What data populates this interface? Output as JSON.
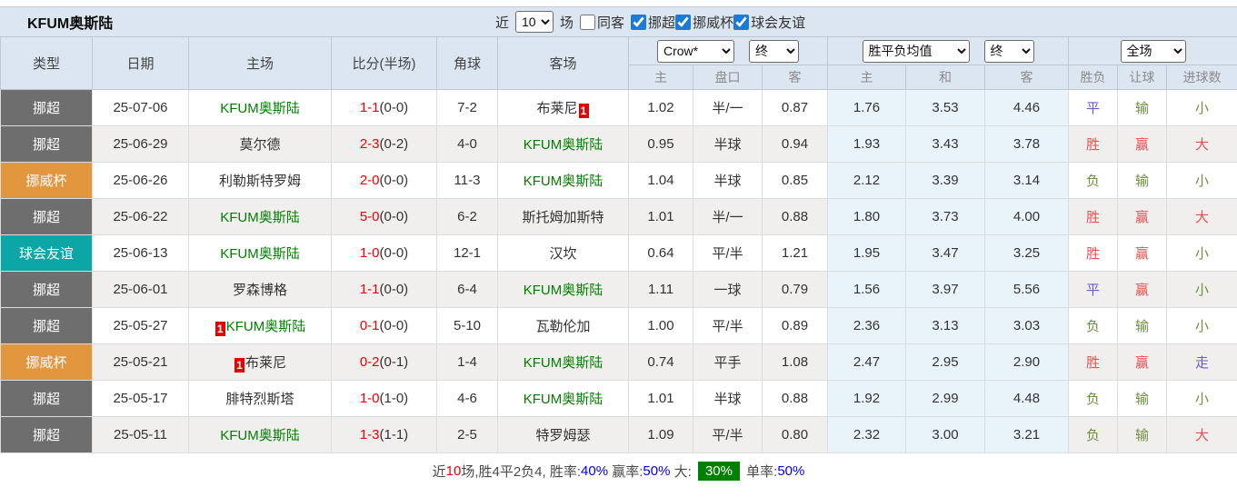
{
  "header": {
    "title": "KFUM奥斯陆",
    "recent_label": "近",
    "recent_value": "10",
    "matches_label": "场",
    "same_away_label": "同客",
    "same_away_checked": false,
    "league_filters": [
      {
        "label": "挪超",
        "checked": true
      },
      {
        "label": "挪威杯",
        "checked": true
      },
      {
        "label": "球会友谊",
        "checked": true
      }
    ]
  },
  "table": {
    "left_headers": [
      "类型",
      "日期",
      "主场",
      "比分(半场)",
      "角球",
      "客场"
    ],
    "selects": {
      "bookmaker": "Crow*",
      "bookmaker_time": "终",
      "avg": "胜平负均值",
      "avg_time": "终",
      "period": "全场"
    },
    "sub_headers": [
      "主",
      "盘口",
      "客",
      "主",
      "和",
      "客",
      "胜负",
      "让球",
      "进球数"
    ]
  },
  "colors": {
    "league_nc": "#6e6e6e",
    "league_cup": "#e2963e",
    "league_friendly": "#0ca6a6",
    "team_green": "#008000",
    "score_red": "#ee0000",
    "result_win_red": "#e85050",
    "result_lose_green": "#6f8f3f",
    "result_draw_purple": "#6a5acd",
    "avg_col_bg": "#e9f3fa",
    "header_bg": "#dce6f0",
    "footer_badge_green": "#008000"
  },
  "rows": [
    {
      "league": "挪超",
      "league_key": "nc",
      "date": "25-07-06",
      "home": {
        "name": "KFUM奥斯陆",
        "green": true
      },
      "away": {
        "name": "布莱尼",
        "green": false,
        "badge": "1",
        "badge_pos": "after"
      },
      "score": "1-1",
      "half": "(0-0)",
      "corner": "7-2",
      "crow": [
        "1.02",
        "半/一",
        "0.87"
      ],
      "avg": [
        "1.76",
        "3.53",
        "4.46"
      ],
      "results": [
        {
          "text": "平",
          "color": "draw"
        },
        {
          "text": "输",
          "color": "lose"
        },
        {
          "text": "小",
          "color": "lose"
        }
      ]
    },
    {
      "league": "挪超",
      "league_key": "nc",
      "date": "25-06-29",
      "home": {
        "name": "莫尔德",
        "green": false
      },
      "away": {
        "name": "KFUM奥斯陆",
        "green": true
      },
      "score": "2-3",
      "half": "(0-2)",
      "corner": "4-0",
      "crow": [
        "0.95",
        "半球",
        "0.94"
      ],
      "avg": [
        "1.93",
        "3.43",
        "3.78"
      ],
      "results": [
        {
          "text": "胜",
          "color": "win"
        },
        {
          "text": "赢",
          "color": "win"
        },
        {
          "text": "大",
          "color": "win"
        }
      ]
    },
    {
      "league": "挪威杯",
      "league_key": "cup",
      "date": "25-06-26",
      "home": {
        "name": "利勒斯特罗姆",
        "green": false
      },
      "away": {
        "name": "KFUM奥斯陆",
        "green": true
      },
      "score": "2-0",
      "half": "(0-0)",
      "corner": "11-3",
      "crow": [
        "1.04",
        "半球",
        "0.85"
      ],
      "avg": [
        "2.12",
        "3.39",
        "3.14"
      ],
      "results": [
        {
          "text": "负",
          "color": "lose"
        },
        {
          "text": "输",
          "color": "lose"
        },
        {
          "text": "小",
          "color": "lose"
        }
      ]
    },
    {
      "league": "挪超",
      "league_key": "nc",
      "date": "25-06-22",
      "home": {
        "name": "KFUM奥斯陆",
        "green": true
      },
      "away": {
        "name": "斯托姆加斯特",
        "green": false
      },
      "score": "5-0",
      "half": "(0-0)",
      "corner": "6-2",
      "crow": [
        "1.01",
        "半/一",
        "0.88"
      ],
      "avg": [
        "1.80",
        "3.73",
        "4.00"
      ],
      "results": [
        {
          "text": "胜",
          "color": "win"
        },
        {
          "text": "赢",
          "color": "win"
        },
        {
          "text": "大",
          "color": "win"
        }
      ]
    },
    {
      "league": "球会友谊",
      "league_key": "fr",
      "date": "25-06-13",
      "home": {
        "name": "KFUM奥斯陆",
        "green": true
      },
      "away": {
        "name": "汉坎",
        "green": false
      },
      "score": "1-0",
      "half": "(0-0)",
      "corner": "12-1",
      "crow": [
        "0.64",
        "平/半",
        "1.21"
      ],
      "avg": [
        "1.95",
        "3.47",
        "3.25"
      ],
      "results": [
        {
          "text": "胜",
          "color": "win"
        },
        {
          "text": "赢",
          "color": "win"
        },
        {
          "text": "小",
          "color": "lose"
        }
      ]
    },
    {
      "league": "挪超",
      "league_key": "nc",
      "date": "25-06-01",
      "home": {
        "name": "罗森博格",
        "green": false
      },
      "away": {
        "name": "KFUM奥斯陆",
        "green": true
      },
      "score": "1-1",
      "half": "(0-0)",
      "corner": "6-4",
      "crow": [
        "1.11",
        "一球",
        "0.79"
      ],
      "avg": [
        "1.56",
        "3.97",
        "5.56"
      ],
      "results": [
        {
          "text": "平",
          "color": "draw"
        },
        {
          "text": "赢",
          "color": "win"
        },
        {
          "text": "小",
          "color": "lose"
        }
      ]
    },
    {
      "league": "挪超",
      "league_key": "nc",
      "date": "25-05-27",
      "home": {
        "name": "KFUM奥斯陆",
        "green": true,
        "badge": "1",
        "badge_pos": "before"
      },
      "away": {
        "name": "瓦勒伦加",
        "green": false
      },
      "score": "0-1",
      "half": "(0-0)",
      "corner": "5-10",
      "crow": [
        "1.00",
        "平/半",
        "0.89"
      ],
      "avg": [
        "2.36",
        "3.13",
        "3.03"
      ],
      "results": [
        {
          "text": "负",
          "color": "lose"
        },
        {
          "text": "输",
          "color": "lose"
        },
        {
          "text": "小",
          "color": "lose"
        }
      ]
    },
    {
      "league": "挪威杯",
      "league_key": "cup",
      "date": "25-05-21",
      "home": {
        "name": "布莱尼",
        "green": false,
        "badge": "1",
        "badge_pos": "before"
      },
      "away": {
        "name": "KFUM奥斯陆",
        "green": true
      },
      "score": "0-2",
      "half": "(0-1)",
      "corner": "1-4",
      "crow": [
        "0.74",
        "平手",
        "1.08"
      ],
      "avg": [
        "2.47",
        "2.95",
        "2.90"
      ],
      "results": [
        {
          "text": "胜",
          "color": "win"
        },
        {
          "text": "赢",
          "color": "win"
        },
        {
          "text": "走",
          "color": "draw"
        }
      ]
    },
    {
      "league": "挪超",
      "league_key": "nc",
      "date": "25-05-17",
      "home": {
        "name": "腓特烈斯塔",
        "green": false
      },
      "away": {
        "name": "KFUM奥斯陆",
        "green": true
      },
      "score": "1-0",
      "half": "(1-0)",
      "corner": "4-6",
      "crow": [
        "1.01",
        "半球",
        "0.88"
      ],
      "avg": [
        "1.92",
        "2.99",
        "4.48"
      ],
      "results": [
        {
          "text": "负",
          "color": "lose"
        },
        {
          "text": "输",
          "color": "lose"
        },
        {
          "text": "小",
          "color": "lose"
        }
      ]
    },
    {
      "league": "挪超",
      "league_key": "nc",
      "date": "25-05-11",
      "home": {
        "name": "KFUM奥斯陆",
        "green": true
      },
      "away": {
        "name": "特罗姆瑟",
        "green": false
      },
      "score": "1-3",
      "half": "(1-1)",
      "corner": "2-5",
      "crow": [
        "1.09",
        "平/半",
        "0.80"
      ],
      "avg": [
        "2.32",
        "3.00",
        "3.21"
      ],
      "results": [
        {
          "text": "负",
          "color": "lose"
        },
        {
          "text": "输",
          "color": "lose"
        },
        {
          "text": "大",
          "color": "win"
        }
      ]
    }
  ],
  "footer": {
    "segments": [
      {
        "text": "近",
        "style": "plain"
      },
      {
        "text": "10",
        "style": "red"
      },
      {
        "text": "场,胜4平2负4, 胜率:",
        "style": "plain"
      },
      {
        "text": "40%",
        "style": "blue"
      },
      {
        "text": " 赢率:",
        "style": "plain"
      },
      {
        "text": "50%",
        "style": "blue"
      },
      {
        "text": " 大: ",
        "style": "plain"
      },
      {
        "text": "30%",
        "style": "green-badge"
      },
      {
        "text": " 单率:",
        "style": "plain"
      },
      {
        "text": "50%",
        "style": "blue"
      }
    ]
  }
}
